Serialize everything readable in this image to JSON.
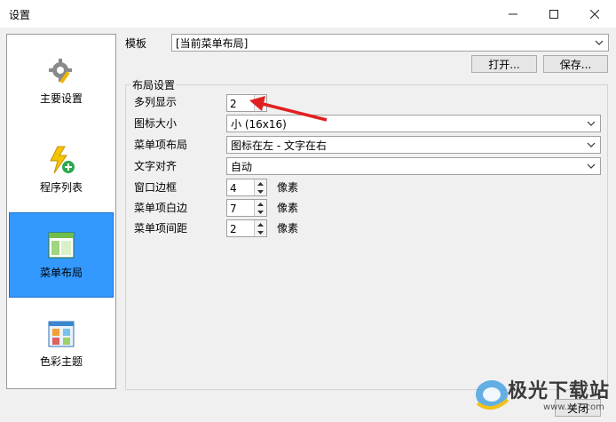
{
  "window": {
    "title": "设置"
  },
  "sidebar": {
    "items": [
      {
        "label": "主要设置",
        "icon": "gear-pencil-icon",
        "active": false
      },
      {
        "label": "程序列表",
        "icon": "lightning-add-icon",
        "active": false
      },
      {
        "label": "菜单布局",
        "icon": "layout-window-icon",
        "active": true
      },
      {
        "label": "色彩主题",
        "icon": "color-palette-icon",
        "active": false
      }
    ]
  },
  "template": {
    "label": "模板",
    "value": "[当前菜单布局]",
    "open_button": "打开...",
    "save_button": "保存..."
  },
  "layout": {
    "group_title": "布局设置",
    "multi_column": {
      "label": "多列显示",
      "value": "2"
    },
    "icon_size": {
      "label": "图标大小",
      "value": "小 (16x16)"
    },
    "item_layout": {
      "label": "菜单项布局",
      "value": "图标在左 - 文字在右"
    },
    "text_align": {
      "label": "文字对齐",
      "value": "自动"
    },
    "window_border": {
      "label": "窗口边框",
      "value": "4",
      "unit": "像素"
    },
    "item_margin": {
      "label": "菜单项白边",
      "value": "7",
      "unit": "像素"
    },
    "item_spacing": {
      "label": "菜单项间距",
      "value": "2",
      "unit": "像素"
    }
  },
  "footer": {
    "close_button": "关闭"
  },
  "watermark": {
    "text": "极光下载站",
    "url": "www.xz7.com"
  },
  "colors": {
    "active_nav": "#3399ff",
    "arrow": "#e02020"
  }
}
